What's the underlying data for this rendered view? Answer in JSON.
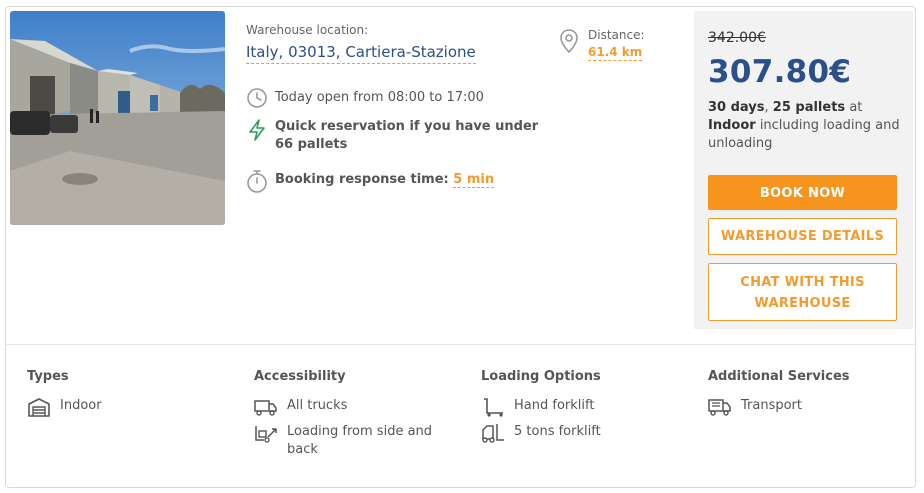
{
  "photo": {
    "alt": "Warehouse exterior photo"
  },
  "location": {
    "label": "Warehouse location:",
    "value": "Italy, 03013, Cartiera-Stazione"
  },
  "distance": {
    "label": "Distance:",
    "value": "61.4 km"
  },
  "features": {
    "hours": "Today open from 08:00 to 17:00",
    "quick": "Quick reservation if you have under 66 pallets",
    "response_label": "Booking response time:",
    "response_value": "5 min"
  },
  "price": {
    "old": "342.00€",
    "new": "307.80€",
    "days": "30 days",
    "pallets": "25 pallets",
    "at": "at",
    "type": "Indoor",
    "including": "including loading and unloading"
  },
  "buttons": {
    "book": "BOOK NOW",
    "details": "WAREHOUSE DETAILS",
    "chat": "CHAT WITH THIS WAREHOUSE"
  },
  "columns": {
    "types": {
      "title": "Types",
      "items": [
        "Indoor"
      ]
    },
    "accessibility": {
      "title": "Accessibility",
      "items": [
        "All trucks",
        "Loading from side and back"
      ]
    },
    "loading": {
      "title": "Loading Options",
      "items": [
        "Hand forklift",
        "5 tons forklift"
      ]
    },
    "services": {
      "title": "Additional Services",
      "items": [
        "Transport"
      ]
    }
  },
  "colors": {
    "accent": "#f7941d",
    "brand": "#2b4f88",
    "quick_icon": "#2e9e5b"
  },
  "icons": [
    "clock-icon",
    "lightning-icon",
    "stopwatch-icon",
    "map-pin-icon",
    "warehouse-icon",
    "truck-icon",
    "side-loading-icon",
    "hand-forklift-icon",
    "forklift-icon",
    "transport-truck-icon"
  ]
}
